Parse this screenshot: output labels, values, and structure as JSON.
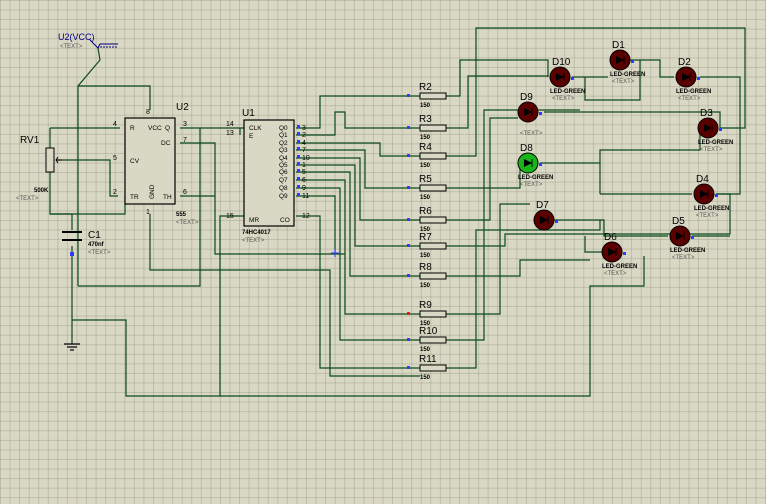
{
  "power": {
    "label": "U2(VCC)",
    "text": "<TEXT>"
  },
  "u2": {
    "ref": "U2",
    "part": "555",
    "text": "<TEXT>",
    "pins": {
      "r": "R",
      "vcc": "VCC",
      "q": "Q",
      "dc": "DC",
      "cv": "CV",
      "tr": "TR",
      "gnd": "GND",
      "th": "TH"
    },
    "pin_numbers": {
      "r": "4",
      "vcc": "8",
      "q": "3",
      "dc": "7",
      "cv": "5",
      "tr": "2",
      "gnd": "1",
      "th": "6"
    }
  },
  "u1": {
    "ref": "U1",
    "part": "74HC4017",
    "text": "<TEXT>",
    "pins": {
      "clk": "CLK",
      "e": "E",
      "mr": "MR",
      "co": "CO",
      "q": [
        "Q0",
        "Q1",
        "Q2",
        "Q3",
        "Q4",
        "Q5",
        "Q6",
        "Q7",
        "Q8",
        "Q9"
      ]
    },
    "pin_numbers": {
      "clk": "14",
      "e": "13",
      "mr": "15",
      "co": "12",
      "q": [
        "3",
        "2",
        "4",
        "7",
        "10",
        "1",
        "5",
        "6",
        "9",
        "11"
      ]
    }
  },
  "rv1": {
    "ref": "RV1",
    "value": "500K",
    "text": "<TEXT>"
  },
  "c1": {
    "ref": "C1",
    "value": "470nf",
    "text": "<TEXT>"
  },
  "resistors": [
    {
      "ref": "R2",
      "value": "150"
    },
    {
      "ref": "R3",
      "value": "150"
    },
    {
      "ref": "R4",
      "value": "150"
    },
    {
      "ref": "R5",
      "value": "150"
    },
    {
      "ref": "R6",
      "value": "150"
    },
    {
      "ref": "R7",
      "value": "150"
    },
    {
      "ref": "R8",
      "value": "150"
    },
    {
      "ref": "R9",
      "value": "150"
    },
    {
      "ref": "R10",
      "value": "150"
    },
    {
      "ref": "R11",
      "value": "150"
    }
  ],
  "leds": [
    {
      "ref": "D1",
      "part": "LED-GREEN",
      "text": "<TEXT>",
      "lit": false
    },
    {
      "ref": "D2",
      "part": "LED-GREEN",
      "text": "<TEXT>",
      "lit": false
    },
    {
      "ref": "D3",
      "part": "LED-GREEN",
      "text": "<TEXT>",
      "lit": false
    },
    {
      "ref": "D4",
      "part": "LED-GREEN",
      "text": "<TEXT>",
      "lit": false
    },
    {
      "ref": "D5",
      "part": "LED-GREEN",
      "text": "<TEXT>",
      "lit": false
    },
    {
      "ref": "D6",
      "part": "LED-GREEN",
      "text": "<TEXT>",
      "lit": false
    },
    {
      "ref": "D7",
      "part": "",
      "text": "",
      "lit": false
    },
    {
      "ref": "D8",
      "part": "LED-GREEN",
      "text": "<TEXT>",
      "lit": true
    },
    {
      "ref": "D9",
      "part": "",
      "text": "<TEXT>",
      "lit": false
    },
    {
      "ref": "D10",
      "part": "LED-GREEN",
      "text": "<TEXT>",
      "lit": false
    }
  ],
  "colors": {
    "wire": "#0b4a1a",
    "led_off": "#5a0000",
    "led_on": "#19b419",
    "pin_marker": "#2a3cff",
    "body": "#d9d8c4"
  }
}
